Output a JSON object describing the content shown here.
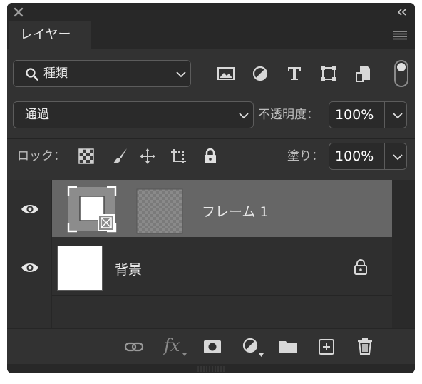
{
  "panel": {
    "tab_label": "レイヤー"
  },
  "filter": {
    "kind_label": "種類",
    "filter_icons": [
      "image-filter-icon",
      "adjustment-filter-icon",
      "type-filter-icon",
      "shape-filter-icon",
      "smart-object-filter-icon"
    ],
    "filter_enabled": true
  },
  "blend": {
    "mode": "通過",
    "opacity_label": "不透明度：",
    "opacity_value": "100%"
  },
  "lock": {
    "label": "ロック：",
    "icons": [
      "lock-transparent-pixels-icon",
      "lock-image-pixels-icon",
      "lock-position-icon",
      "lock-artboard-icon",
      "lock-all-icon"
    ],
    "fill_label": "塗り：",
    "fill_value": "100%"
  },
  "layers": [
    {
      "name": "フレーム 1",
      "visible": true,
      "selected": true,
      "type": "frame"
    },
    {
      "name": "背景",
      "visible": true,
      "selected": false,
      "locked": true,
      "type": "background"
    }
  ],
  "footer": {
    "icons": [
      "link-layers-icon",
      "layer-style-fx-icon",
      "add-mask-icon",
      "new-adjustment-layer-icon",
      "new-group-folder-icon",
      "new-layer-icon",
      "delete-layer-icon"
    ],
    "fx_label": "fx"
  },
  "colors": {
    "panel_bg": "#323232",
    "selected_row": "#666666",
    "text": "#e8e8e8"
  }
}
